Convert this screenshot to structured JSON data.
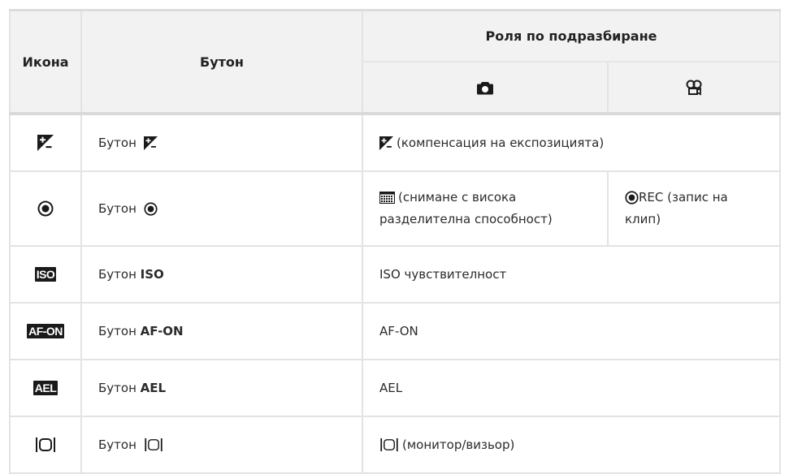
{
  "header": {
    "icon_col": "Икона",
    "button_col": "Бутон",
    "default_role": "Роля по подразбиране"
  },
  "rows": [
    {
      "icon": "exposure-comp-icon",
      "button_prefix": "Бутон",
      "photo_text": "(компенсация на експозицията)"
    },
    {
      "icon": "record-icon",
      "button_prefix": "Бутон",
      "photo_text_l1": "(снимане с висока",
      "photo_text_l2": "разделителна способност)",
      "movie_text_l1": "REC (запис на",
      "movie_text_l2": "клип)"
    },
    {
      "icon": "iso-icon",
      "badge": "ISO",
      "button_prefix": "Бутон",
      "button_bold": "ISO",
      "photo_text": "ISO чувствителност"
    },
    {
      "icon": "af-on-icon",
      "badge": "AF-ON",
      "button_prefix": "Бутон",
      "button_bold": "AF-ON",
      "photo_text": "AF-ON"
    },
    {
      "icon": "ael-icon",
      "badge": "AEL",
      "button_prefix": "Бутон",
      "button_bold": "AEL",
      "photo_text": "AEL"
    },
    {
      "icon": "monitor-viewfinder-icon",
      "button_prefix": "Бутон",
      "photo_text": "(монитор/визьор)"
    }
  ]
}
